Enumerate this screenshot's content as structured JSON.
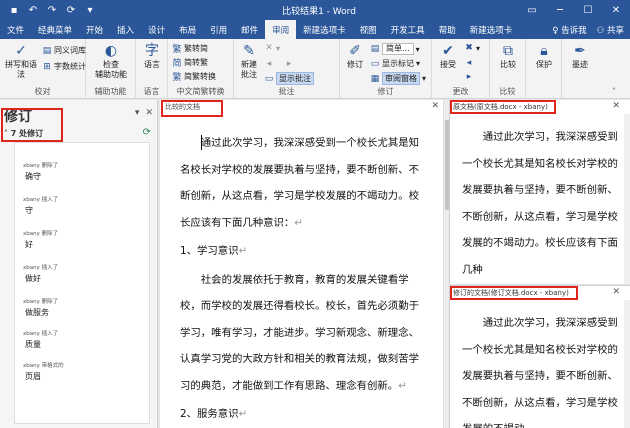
{
  "window": {
    "title": "比较结果1 - Word",
    "qat_icons": [
      "save-icon",
      "undo-icon",
      "redo-icon",
      "refresh-icon",
      "quick-access-more-icon"
    ]
  },
  "tabs": [
    "文件",
    "经典菜单",
    "开始",
    "插入",
    "设计",
    "布局",
    "引用",
    "邮件",
    "审阅",
    "新建选项卡",
    "视图",
    "开发工具",
    "帮助",
    "新建选项卡"
  ],
  "active_tab": "审阅",
  "tabbar_right": {
    "tell_me": "告诉我",
    "share": "共享"
  },
  "ribbon": {
    "proofing": {
      "spell": "拼写和语法",
      "thesaurus": "同义词库",
      "wordcount": "字数统计",
      "label": "校对"
    },
    "accessibility": {
      "check": "检查",
      "check2": "辅助功能",
      "label": "辅助功能"
    },
    "language": {
      "btn": "语言",
      "label": "语言"
    },
    "chinese": {
      "to_trad": "繁转简",
      "to_simp": "简转繁",
      "convert": "简繁转换",
      "label": "中文简繁转换"
    },
    "comments": {
      "new": "新建",
      "new2": "批注",
      "show": "显示批注",
      "label": "批注"
    },
    "tracking": {
      "track": "修订",
      "markup": "简单...",
      "show_markup": "显示标记",
      "pane": "审阅窗格",
      "label": "修订"
    },
    "changes": {
      "accept": "接受",
      "label": "更改"
    },
    "compare": {
      "btn": "比较",
      "label": "比较"
    },
    "protect": {
      "btn": "保护"
    },
    "ink": {
      "btn": "墨迹"
    }
  },
  "revisions_pane": {
    "title": "修订",
    "count": "7 处修订",
    "items": [
      {
        "author": "xbany 删除了",
        "text": "确守"
      },
      {
        "author": "xbany 插入了",
        "text": "守"
      },
      {
        "author": "xbany 删除了",
        "text": "好"
      },
      {
        "author": "xbany 插入了",
        "text": "做好"
      },
      {
        "author": "xbany 删除了",
        "text": "做服务"
      },
      {
        "author": "xbany 插入了",
        "text": "质量"
      },
      {
        "author": "xbany 带格式的",
        "text": "页眉"
      }
    ]
  },
  "compared_doc": {
    "label": "比较的文档",
    "p1": "通过此次学习，我深深感受到一个校长尤其是知名校长对学校的发展要执着与坚持，要不断创新、不断创新，从这点看，学习是学校发展的不竭动力。校长应该有下面几种意识：",
    "h1": "1、学习意识",
    "p2": "社会的发展依托于教育，教育的发展关键看学校，而学校的发展还得看校长。校长，首先必须勤于学习，唯有学习，才能进步。学习新观念、新理念、认真学习党的大政方针和相关的教育法规，做刻苦学习的典范，才能做到工作有思路、理念有创新。",
    "h2": "2、服务意识"
  },
  "original_doc": {
    "label": "原文档(原文档.docx - xbany)",
    "text": "通过此次学习，我深深感受到一个校长尤其是知名校长对学校的发展要执着与坚持，要不断创新、不断创新，从这点看，学习是学校发展的不竭动力。校长应该有下面几种"
  },
  "revised_doc": {
    "label": "修订的文档(修订文档.docx - xbany)",
    "text": "通过此次学习，我深深感受到一个校长尤其是知名校长对学校的发展要执着与坚持，要不断创新、不断创新，从这点看，学习是学校发展的不竭动"
  },
  "colors": {
    "title_blue": "#2b579a",
    "highlight_red": "#e0261b"
  }
}
